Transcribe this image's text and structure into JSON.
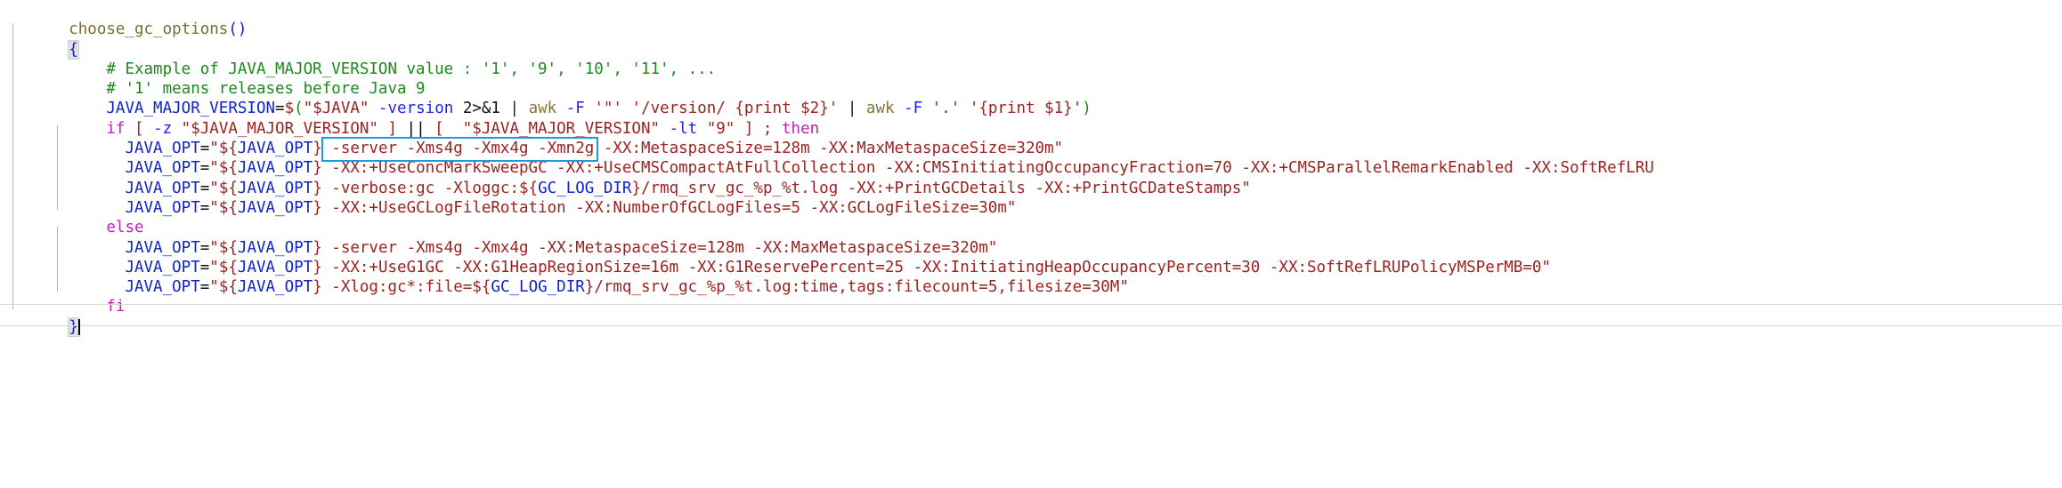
{
  "editor": {
    "language": "shell",
    "background_color": "#ffffff",
    "selection_border_color": "#1a9ae0",
    "indent_guide_color": "#b4b4b4",
    "brace_match_background": "#e0e0e0",
    "colors": {
      "function": "#7a6c2e",
      "comment": "#1a8a1a",
      "variable": "#1122cc",
      "string": "#9c2222",
      "keyword": "#bb22bb",
      "flag": "#2222ee",
      "command": "#84763a",
      "plain": "#000000"
    }
  },
  "code": {
    "line01": {
      "indent": "",
      "name": "choose_gc_options",
      "parens": "()"
    },
    "line02": {
      "brace": "{"
    },
    "line03": {
      "indent": "    ",
      "comment": "# Example of JAVA_MAJOR_VERSION value : '1', '9', '10', '11', ..."
    },
    "line04": {
      "indent": "    ",
      "comment": "# '1' means releases before Java 9"
    },
    "line05": {
      "indent": "    ",
      "var": "JAVA_MAJOR_VERSION",
      "eq": "=",
      "dollar": "$",
      "open": "(",
      "str_java": "\"$JAVA\"",
      "space1": " ",
      "flag_version": "-version",
      "redirect": " 2>&1 ",
      "pipe1": "|",
      "cmd_awk1": " awk ",
      "flag_F1": "-F",
      "awk_arg1": " '\"' '/version/ {print $2}' ",
      "pipe2": "|",
      "cmd_awk2": " awk ",
      "flag_F2": "-F",
      "awk_arg2": " '.' '{print $1}'",
      "close": ")"
    },
    "line06": {
      "indent": "    ",
      "kw_if": "if",
      "b1": " [ ",
      "flag_z": "-z",
      "str1": " \"$JAVA_MAJOR_VERSION\" ",
      "b2": "] ",
      "oror": "|| ",
      "b3": "[ ",
      "str2": " \"$JAVA_MAJOR_VERSION\" ",
      "flag_lt": "-lt",
      "str3": " \"9\" ",
      "b4": "] ; ",
      "kw_then": "then"
    },
    "line07": {
      "indent": "      ",
      "var": "JAVA_OPT",
      "eq": "=",
      "q1": "\"",
      "dollar_brace": "${",
      "inner_var": "JAVA_OPT",
      "cbrace": "}",
      "selected": " -server -Xms4g -Xmx4g -Xmn2g",
      "rest": " -XX:MetaspaceSize=128m -XX:MaxMetaspaceSize=320m\""
    },
    "line08": {
      "indent": "      ",
      "var": "JAVA_OPT",
      "eq": "=",
      "q1": "\"",
      "dollar_brace": "${",
      "inner_var": "JAVA_OPT",
      "cbrace": "}",
      "rest": " -XX:+UseConcMarkSweepGC -XX:+UseCMSCompactAtFullCollection -XX:CMSInitiatingOccupancyFraction=70 -XX:+CMSParallelRemarkEnabled -XX:SoftRefLRU"
    },
    "line09": {
      "indent": "      ",
      "var": "JAVA_OPT",
      "eq": "=",
      "q1": "\"",
      "dollar_brace": "${",
      "inner_var": "JAVA_OPT",
      "cbrace": "}",
      "mid": " -verbose:gc -Xloggc:$",
      "ob2": "{",
      "logdir": "GC_LOG_DIR",
      "cb2": "}",
      "rest": "/rmq_srv_gc_%p_%t.log -XX:+PrintGCDetails -XX:+PrintGCDateStamps\""
    },
    "line10": {
      "indent": "      ",
      "var": "JAVA_OPT",
      "eq": "=",
      "q1": "\"",
      "dollar_brace": "${",
      "inner_var": "JAVA_OPT",
      "cbrace": "}",
      "rest": " -XX:+UseGCLogFileRotation -XX:NumberOfGCLogFiles=5 -XX:GCLogFileSize=30m\""
    },
    "line11": {
      "indent": "    ",
      "kw_else": "else"
    },
    "line12": {
      "indent": "      ",
      "var": "JAVA_OPT",
      "eq": "=",
      "q1": "\"",
      "dollar_brace": "${",
      "inner_var": "JAVA_OPT",
      "cbrace": "}",
      "rest": " -server -Xms4g -Xmx4g -XX:MetaspaceSize=128m -XX:MaxMetaspaceSize=320m\""
    },
    "line13": {
      "indent": "      ",
      "var": "JAVA_OPT",
      "eq": "=",
      "q1": "\"",
      "dollar_brace": "${",
      "inner_var": "JAVA_OPT",
      "cbrace": "}",
      "rest": " -XX:+UseG1GC -XX:G1HeapRegionSize=16m -XX:G1ReservePercent=25 -XX:InitiatingHeapOccupancyPercent=30 -XX:SoftRefLRUPolicyMSPerMB=0\""
    },
    "line14": {
      "indent": "      ",
      "var": "JAVA_OPT",
      "eq": "=",
      "q1": "\"",
      "dollar_brace": "${",
      "inner_var": "JAVA_OPT",
      "cbrace": "}",
      "mid": " -Xlog:gc*:file=$",
      "ob2": "{",
      "logdir": "GC_LOG_DIR",
      "cb2": "}",
      "rest": "/rmq_srv_gc_%p_%t.log:time,tags:filecount=5,filesize=30M\""
    },
    "line15": {
      "indent": "    ",
      "kw_fi": "fi"
    },
    "line16": {
      "brace": "}"
    }
  }
}
